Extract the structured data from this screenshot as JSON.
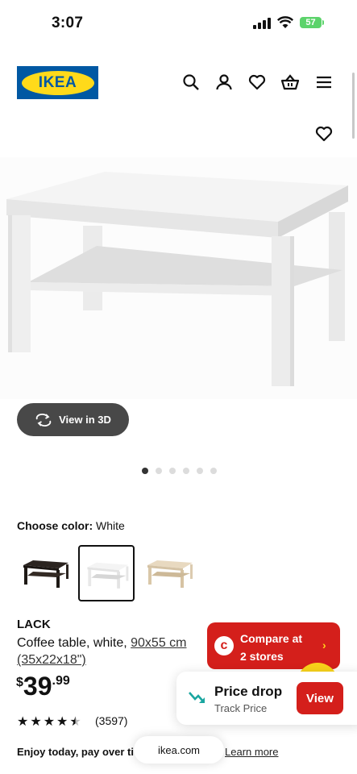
{
  "status_bar": {
    "time": "3:07",
    "battery": "57"
  },
  "header": {
    "logo_text": "IKEA",
    "icons": [
      "search-icon",
      "account-icon",
      "favorites-icon",
      "cart-icon",
      "menu-icon"
    ]
  },
  "product_image": {
    "favorite_icon": "heart-icon"
  },
  "view3d": {
    "label": "View in 3D"
  },
  "carousel": {
    "count": 6,
    "active": 1
  },
  "color": {
    "label": "Choose color:",
    "value": "White"
  },
  "swatches": [
    {
      "name": "black-brown",
      "selected": false
    },
    {
      "name": "white",
      "selected": true
    },
    {
      "name": "white-stained-oak",
      "selected": false
    }
  ],
  "product": {
    "name": "LACK",
    "description_plain": "Coffee table, white, ",
    "dimensions": "90x55 cm",
    "dimensions_imperial": "(35x22x18\")",
    "price_currency": "$",
    "price_int": "39",
    "price_dec": ".99",
    "rating": 4.5,
    "reviews": "(3597)"
  },
  "footer": {
    "enjoy": "Enjoy today, pay over ti",
    "url": "ikea.com",
    "learn_more": "Learn more"
  },
  "compare": {
    "line1": "Compare at",
    "line2": "2 stores"
  },
  "price_drop": {
    "title": "Price drop",
    "subtitle": "Track Price",
    "button": "View"
  },
  "colors": {
    "ikea_blue": "#0058a3",
    "ikea_yellow": "#ffda1a",
    "red": "#d41f1b"
  }
}
